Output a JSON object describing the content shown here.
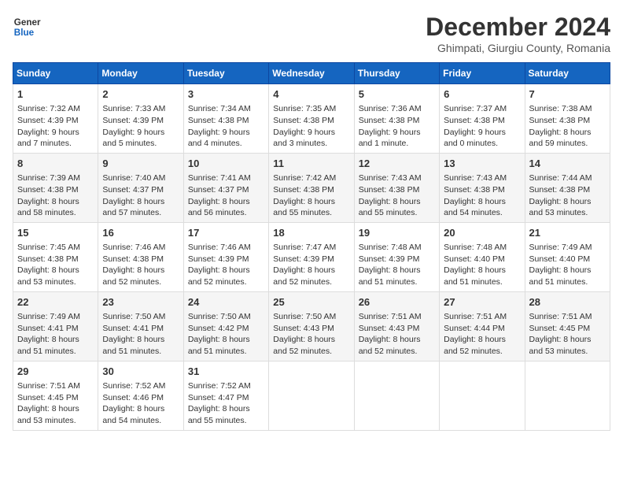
{
  "header": {
    "logo_line1": "General",
    "logo_line2": "Blue",
    "title": "December 2024",
    "subtitle": "Ghimpati, Giurgiu County, Romania"
  },
  "weekdays": [
    "Sunday",
    "Monday",
    "Tuesday",
    "Wednesday",
    "Thursday",
    "Friday",
    "Saturday"
  ],
  "weeks": [
    [
      {
        "day": 1,
        "sunrise": "Sunrise: 7:32 AM",
        "sunset": "Sunset: 4:39 PM",
        "daylight": "Daylight: 9 hours and 7 minutes."
      },
      {
        "day": 2,
        "sunrise": "Sunrise: 7:33 AM",
        "sunset": "Sunset: 4:39 PM",
        "daylight": "Daylight: 9 hours and 5 minutes."
      },
      {
        "day": 3,
        "sunrise": "Sunrise: 7:34 AM",
        "sunset": "Sunset: 4:38 PM",
        "daylight": "Daylight: 9 hours and 4 minutes."
      },
      {
        "day": 4,
        "sunrise": "Sunrise: 7:35 AM",
        "sunset": "Sunset: 4:38 PM",
        "daylight": "Daylight: 9 hours and 3 minutes."
      },
      {
        "day": 5,
        "sunrise": "Sunrise: 7:36 AM",
        "sunset": "Sunset: 4:38 PM",
        "daylight": "Daylight: 9 hours and 1 minute."
      },
      {
        "day": 6,
        "sunrise": "Sunrise: 7:37 AM",
        "sunset": "Sunset: 4:38 PM",
        "daylight": "Daylight: 9 hours and 0 minutes."
      },
      {
        "day": 7,
        "sunrise": "Sunrise: 7:38 AM",
        "sunset": "Sunset: 4:38 PM",
        "daylight": "Daylight: 8 hours and 59 minutes."
      }
    ],
    [
      {
        "day": 8,
        "sunrise": "Sunrise: 7:39 AM",
        "sunset": "Sunset: 4:38 PM",
        "daylight": "Daylight: 8 hours and 58 minutes."
      },
      {
        "day": 9,
        "sunrise": "Sunrise: 7:40 AM",
        "sunset": "Sunset: 4:37 PM",
        "daylight": "Daylight: 8 hours and 57 minutes."
      },
      {
        "day": 10,
        "sunrise": "Sunrise: 7:41 AM",
        "sunset": "Sunset: 4:37 PM",
        "daylight": "Daylight: 8 hours and 56 minutes."
      },
      {
        "day": 11,
        "sunrise": "Sunrise: 7:42 AM",
        "sunset": "Sunset: 4:38 PM",
        "daylight": "Daylight: 8 hours and 55 minutes."
      },
      {
        "day": 12,
        "sunrise": "Sunrise: 7:43 AM",
        "sunset": "Sunset: 4:38 PM",
        "daylight": "Daylight: 8 hours and 55 minutes."
      },
      {
        "day": 13,
        "sunrise": "Sunrise: 7:43 AM",
        "sunset": "Sunset: 4:38 PM",
        "daylight": "Daylight: 8 hours and 54 minutes."
      },
      {
        "day": 14,
        "sunrise": "Sunrise: 7:44 AM",
        "sunset": "Sunset: 4:38 PM",
        "daylight": "Daylight: 8 hours and 53 minutes."
      }
    ],
    [
      {
        "day": 15,
        "sunrise": "Sunrise: 7:45 AM",
        "sunset": "Sunset: 4:38 PM",
        "daylight": "Daylight: 8 hours and 53 minutes."
      },
      {
        "day": 16,
        "sunrise": "Sunrise: 7:46 AM",
        "sunset": "Sunset: 4:38 PM",
        "daylight": "Daylight: 8 hours and 52 minutes."
      },
      {
        "day": 17,
        "sunrise": "Sunrise: 7:46 AM",
        "sunset": "Sunset: 4:39 PM",
        "daylight": "Daylight: 8 hours and 52 minutes."
      },
      {
        "day": 18,
        "sunrise": "Sunrise: 7:47 AM",
        "sunset": "Sunset: 4:39 PM",
        "daylight": "Daylight: 8 hours and 52 minutes."
      },
      {
        "day": 19,
        "sunrise": "Sunrise: 7:48 AM",
        "sunset": "Sunset: 4:39 PM",
        "daylight": "Daylight: 8 hours and 51 minutes."
      },
      {
        "day": 20,
        "sunrise": "Sunrise: 7:48 AM",
        "sunset": "Sunset: 4:40 PM",
        "daylight": "Daylight: 8 hours and 51 minutes."
      },
      {
        "day": 21,
        "sunrise": "Sunrise: 7:49 AM",
        "sunset": "Sunset: 4:40 PM",
        "daylight": "Daylight: 8 hours and 51 minutes."
      }
    ],
    [
      {
        "day": 22,
        "sunrise": "Sunrise: 7:49 AM",
        "sunset": "Sunset: 4:41 PM",
        "daylight": "Daylight: 8 hours and 51 minutes."
      },
      {
        "day": 23,
        "sunrise": "Sunrise: 7:50 AM",
        "sunset": "Sunset: 4:41 PM",
        "daylight": "Daylight: 8 hours and 51 minutes."
      },
      {
        "day": 24,
        "sunrise": "Sunrise: 7:50 AM",
        "sunset": "Sunset: 4:42 PM",
        "daylight": "Daylight: 8 hours and 51 minutes."
      },
      {
        "day": 25,
        "sunrise": "Sunrise: 7:50 AM",
        "sunset": "Sunset: 4:43 PM",
        "daylight": "Daylight: 8 hours and 52 minutes."
      },
      {
        "day": 26,
        "sunrise": "Sunrise: 7:51 AM",
        "sunset": "Sunset: 4:43 PM",
        "daylight": "Daylight: 8 hours and 52 minutes."
      },
      {
        "day": 27,
        "sunrise": "Sunrise: 7:51 AM",
        "sunset": "Sunset: 4:44 PM",
        "daylight": "Daylight: 8 hours and 52 minutes."
      },
      {
        "day": 28,
        "sunrise": "Sunrise: 7:51 AM",
        "sunset": "Sunset: 4:45 PM",
        "daylight": "Daylight: 8 hours and 53 minutes."
      }
    ],
    [
      {
        "day": 29,
        "sunrise": "Sunrise: 7:51 AM",
        "sunset": "Sunset: 4:45 PM",
        "daylight": "Daylight: 8 hours and 53 minutes."
      },
      {
        "day": 30,
        "sunrise": "Sunrise: 7:52 AM",
        "sunset": "Sunset: 4:46 PM",
        "daylight": "Daylight: 8 hours and 54 minutes."
      },
      {
        "day": 31,
        "sunrise": "Sunrise: 7:52 AM",
        "sunset": "Sunset: 4:47 PM",
        "daylight": "Daylight: 8 hours and 55 minutes."
      },
      null,
      null,
      null,
      null
    ]
  ]
}
